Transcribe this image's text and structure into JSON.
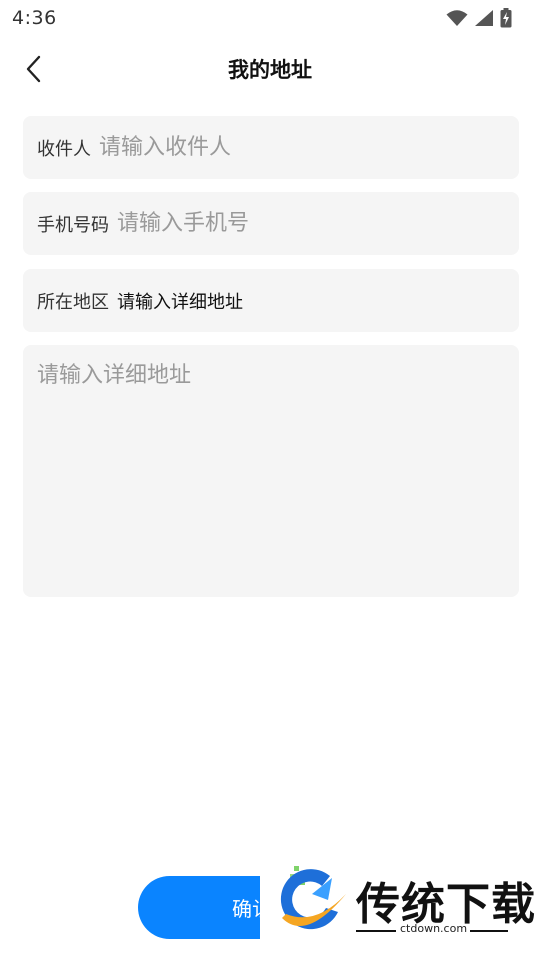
{
  "status_bar": {
    "time": "4:36",
    "icons": [
      "wifi-icon",
      "signal-icon",
      "battery-charging-icon"
    ]
  },
  "header": {
    "back_icon": "chevron-left-icon",
    "title": "我的地址"
  },
  "form": {
    "recipient": {
      "label": "收件人",
      "placeholder": "请输入收件人",
      "value": ""
    },
    "phone": {
      "label": "手机号码",
      "placeholder": "请输入手机号",
      "value": ""
    },
    "region": {
      "label": "所在地区",
      "value": "请输入详细地址"
    },
    "detail": {
      "placeholder": "请输入详细地址",
      "value": ""
    }
  },
  "confirm_button": {
    "label": "确认"
  },
  "watermark": {
    "title": "传统下载",
    "url": "ctdown.com"
  },
  "colors": {
    "accent": "#0a84ff",
    "field_bg": "#f5f5f5",
    "placeholder": "#9a9a9a",
    "text": "#333333"
  }
}
